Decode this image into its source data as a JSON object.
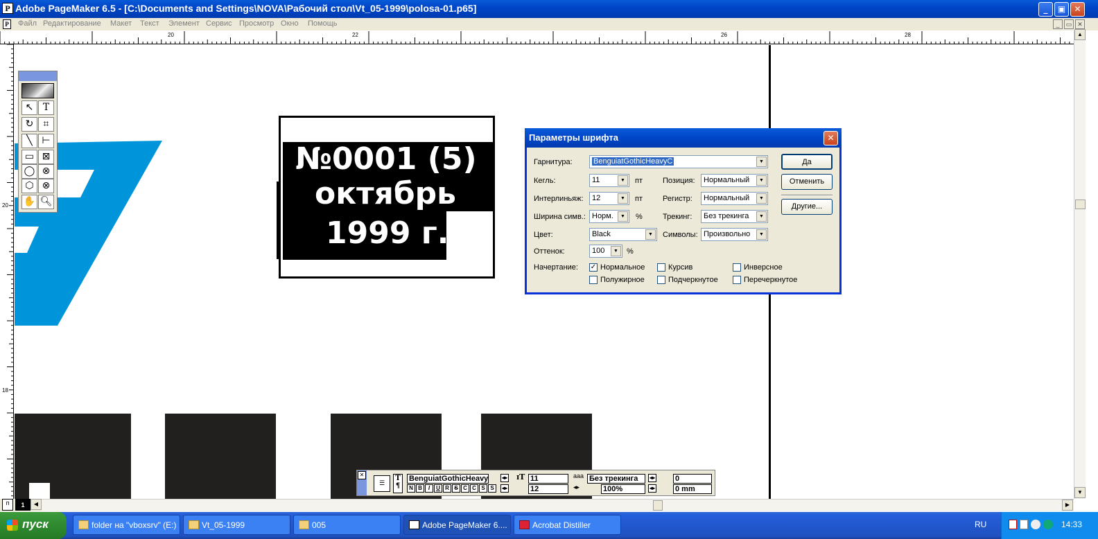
{
  "window": {
    "app_icon": "P",
    "title": "Adobe PageMaker 6.5 - [C:\\Documents and Settings\\NOVA\\Рабочий стол\\Vt_05-1999\\polosa-01.p65]",
    "minimize": "_",
    "maximize": "▣",
    "close": "✕"
  },
  "menu": {
    "items": [
      "Файл",
      "Редактирование",
      "Макет",
      "Текст",
      "Элемент",
      "Сервис",
      "Просмотр",
      "Окно",
      "Помощь"
    ],
    "doc_minimize": "_",
    "doc_restore": "▭",
    "doc_close": "✕"
  },
  "ruler": {
    "h_labels": [
      "20",
      "22",
      "26",
      "28"
    ],
    "v_labels": [
      "20",
      "18"
    ]
  },
  "document": {
    "lines": [
      "№0001 (5)",
      "октябрь",
      "1999 г."
    ]
  },
  "dialog": {
    "title": "Параметры шрифта",
    "close": "✕",
    "labels": {
      "font": "Гарнитура:",
      "size": "Кегль:",
      "leading": "Интерлиньяж:",
      "width": "Ширина симв.:",
      "color": "Цвет:",
      "tint": "Оттенок:",
      "position": "Позиция:",
      "case": "Регистр:",
      "tracking": "Трекинг:",
      "symbols": "Символы:",
      "style": "Начертание:"
    },
    "values": {
      "font": "BenguiatGothicHeavyC",
      "size": "11",
      "leading": "12",
      "width": "Норм.",
      "color": "Black",
      "tint": "100",
      "position": "Нормальный",
      "case": "Нормальный",
      "tracking": "Без трекинга",
      "symbols": "Произвольно"
    },
    "units": {
      "size": "пт",
      "leading": "пт",
      "width": "%",
      "tint": "%"
    },
    "buttons": {
      "ok": "Да",
      "cancel": "Отменить",
      "other": "Другие..."
    },
    "checkboxes": [
      {
        "label": "Нормальное",
        "checked": true
      },
      {
        "label": "Курсив",
        "checked": false
      },
      {
        "label": "Инверсное",
        "checked": false
      },
      {
        "label": "Полужирное",
        "checked": false
      },
      {
        "label": "Подчеркнутое",
        "checked": false
      },
      {
        "label": "Перечеркнутое",
        "checked": false
      }
    ],
    "check_mark": "✓"
  },
  "control_palette": {
    "close": "✕",
    "font": "BenguiatGothicHeavyC",
    "size": "11",
    "leading": "12",
    "tracking": "Без трекинга",
    "width": "100%",
    "kerning": "0",
    "baseline": "0 mm",
    "style_buttons": [
      "N",
      "B",
      "I",
      "U",
      "R",
      "S",
      "C",
      "C",
      "S",
      "S"
    ]
  },
  "page_indicator": {
    "left_label": "п",
    "page": "1"
  },
  "taskbar": {
    "start": "пуск",
    "tasks": [
      {
        "label": "folder на \"vboxsrv\" (E:)",
        "active": false
      },
      {
        "label": "Vt_05-1999",
        "active": false
      },
      {
        "label": "005",
        "active": false
      },
      {
        "label": "Adobe PageMaker 6....",
        "active": true
      },
      {
        "label": "Acrobat Distiller",
        "active": false
      }
    ],
    "language": "RU",
    "clock": "14:33"
  },
  "colors": {
    "accent_blue": "#0095da",
    "title_blue": "#0046c8"
  }
}
